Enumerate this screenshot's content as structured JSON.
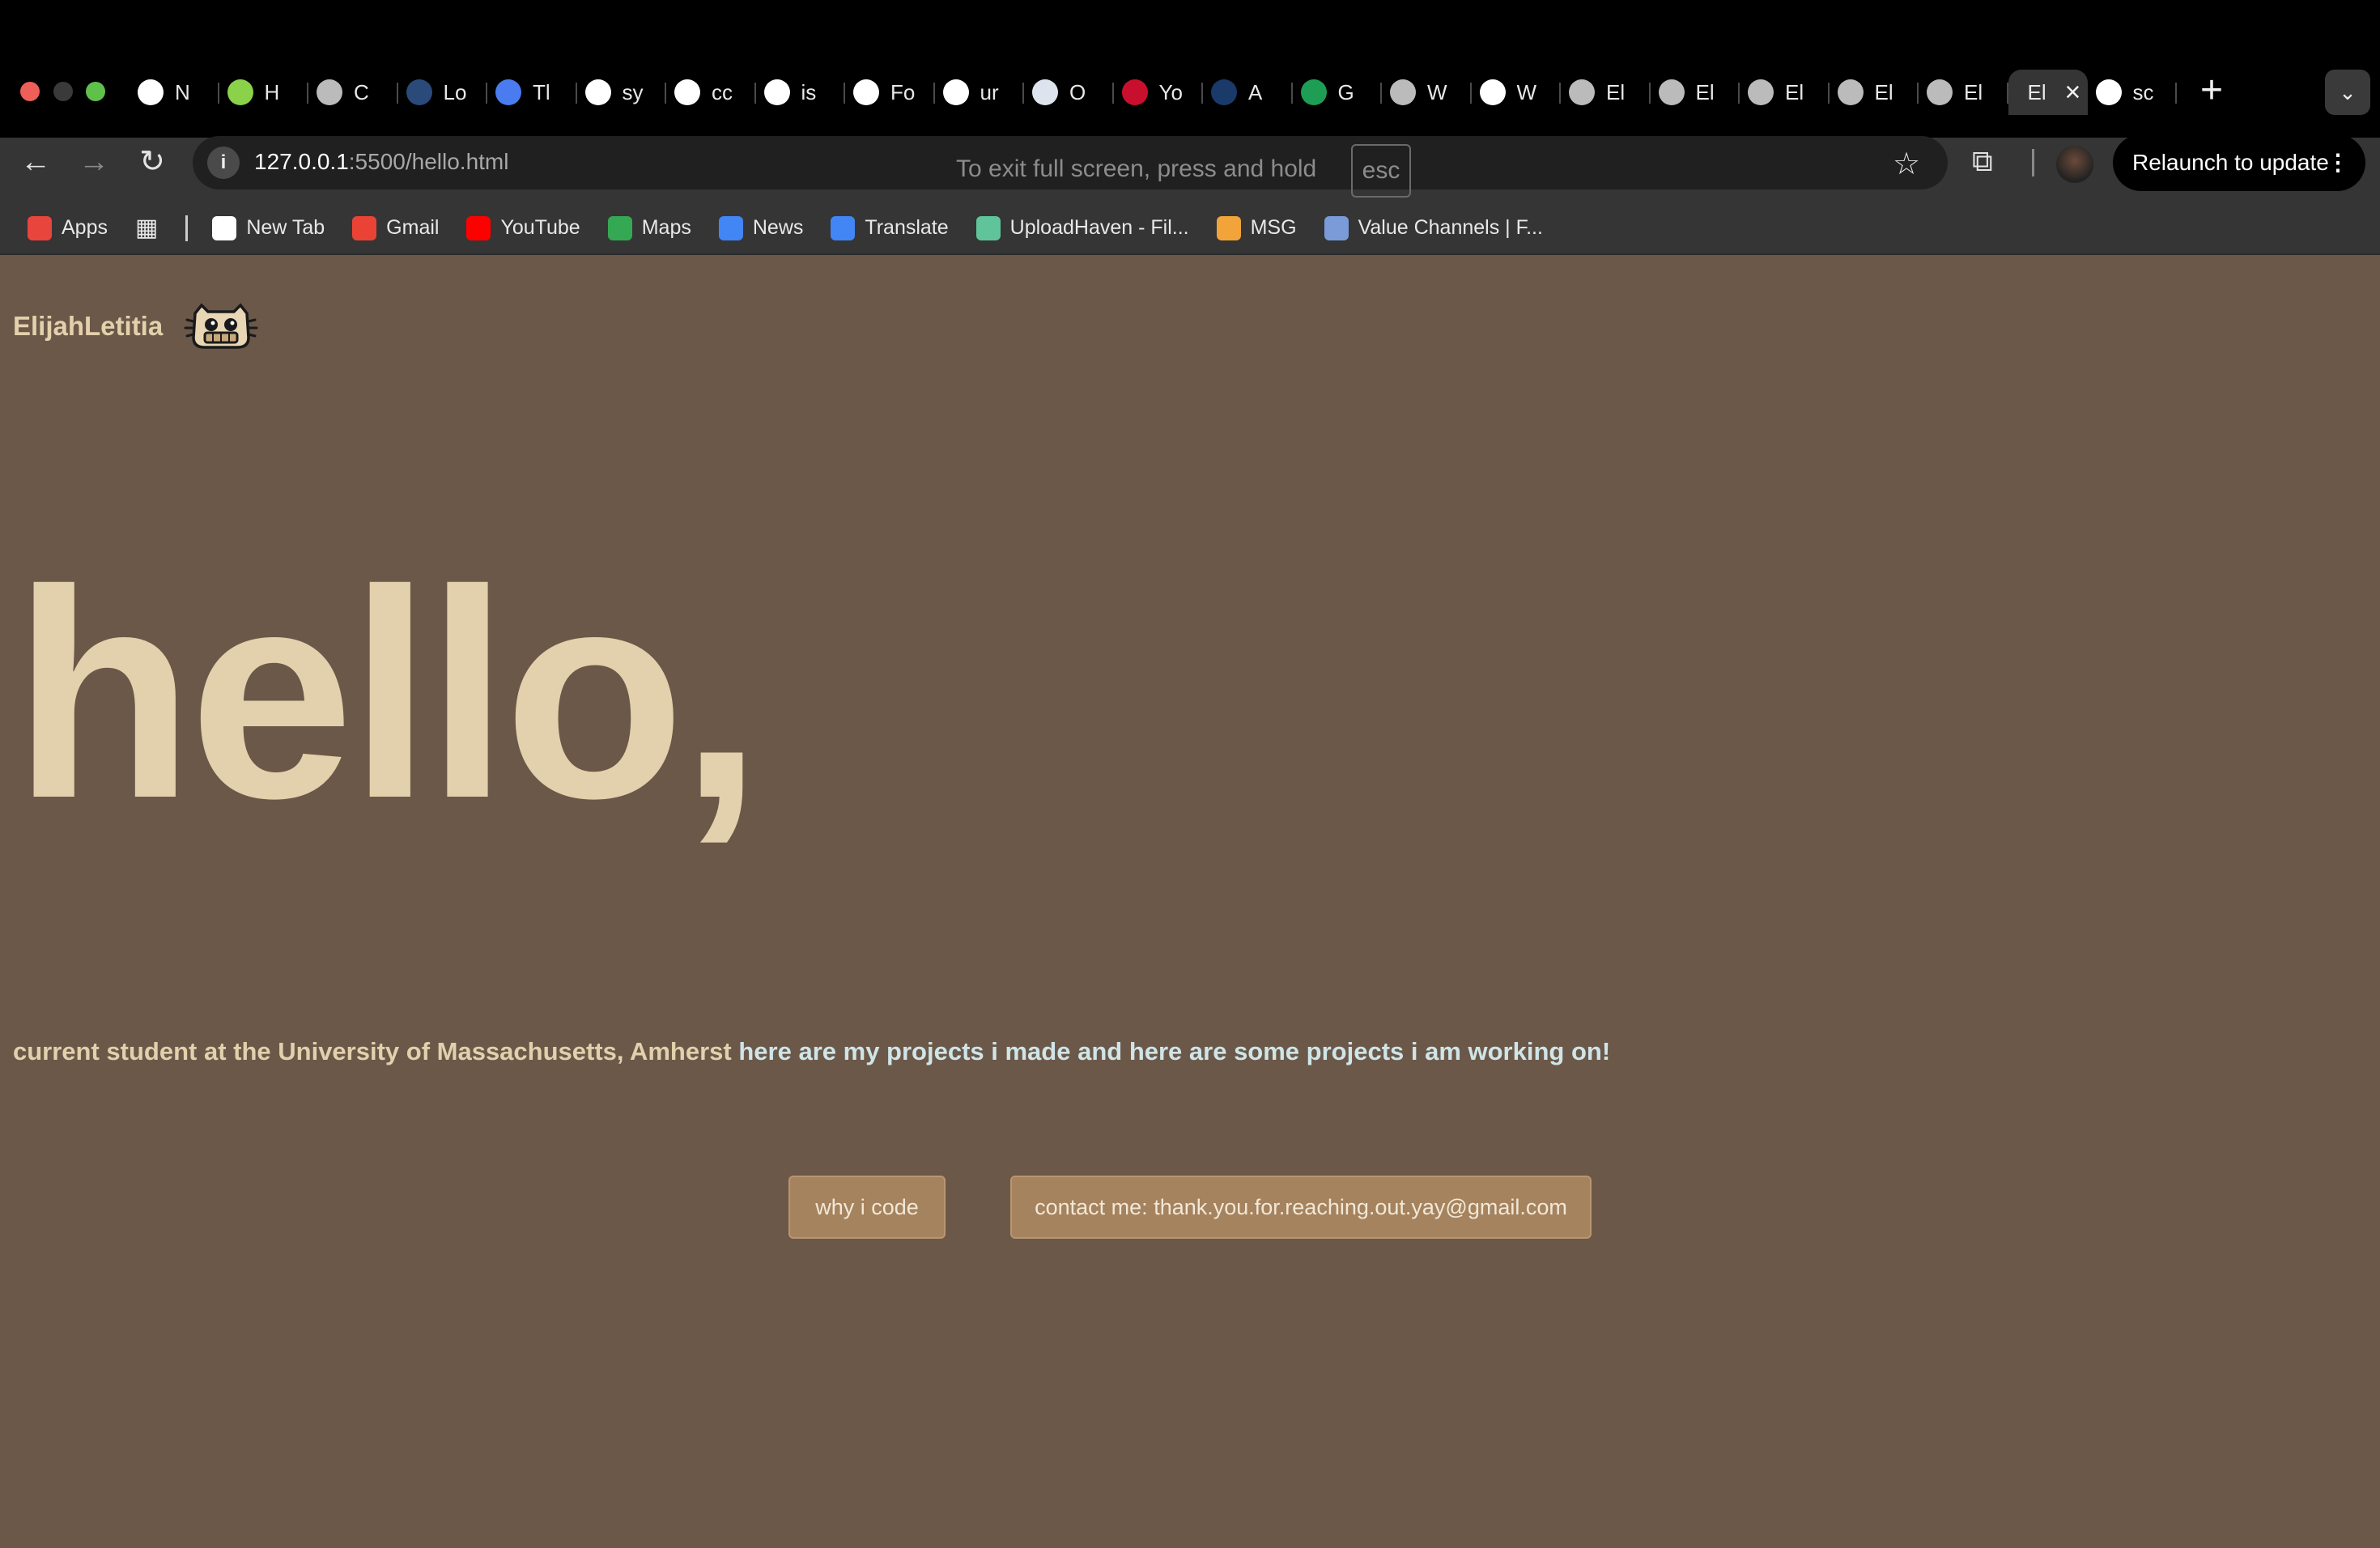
{
  "browser": {
    "tabs": [
      {
        "title": "N",
        "icon": "chrome-icon",
        "color": "#ffffff"
      },
      {
        "title": "H",
        "icon": "hackerrank-icon",
        "color": "#8bd24a"
      },
      {
        "title": "C",
        "icon": "globe-icon",
        "color": "#bbbbbb"
      },
      {
        "title": "Lo",
        "icon": "fsa-icon",
        "color": "#2a4a7a"
      },
      {
        "title": "Tl",
        "icon": "docs-icon",
        "color": "#4a7cf0"
      },
      {
        "title": "sy",
        "icon": "google-icon",
        "color": "#ffffff"
      },
      {
        "title": "cc",
        "icon": "google-icon",
        "color": "#ffffff"
      },
      {
        "title": "is",
        "icon": "google-icon",
        "color": "#ffffff"
      },
      {
        "title": "Fo",
        "icon": "openai-icon",
        "color": "#ffffff"
      },
      {
        "title": "ur",
        "icon": "google-icon",
        "color": "#ffffff"
      },
      {
        "title": "O",
        "icon": "shield-icon",
        "color": "#dde4ee"
      },
      {
        "title": "Yo",
        "icon": "flag-icon",
        "color": "#c8102e"
      },
      {
        "title": "A",
        "icon": "globe-dark-icon",
        "color": "#1a3a6a"
      },
      {
        "title": "G",
        "icon": "sheets-icon",
        "color": "#1e9e55"
      },
      {
        "title": "W",
        "icon": "globe-icon",
        "color": "#bbbbbb"
      },
      {
        "title": "W",
        "icon": "openai-icon",
        "color": "#ffffff"
      },
      {
        "title": "El",
        "icon": "globe-icon",
        "color": "#bbbbbb"
      },
      {
        "title": "El",
        "icon": "globe-icon",
        "color": "#bbbbbb"
      },
      {
        "title": "El",
        "icon": "globe-icon",
        "color": "#bbbbbb"
      },
      {
        "title": "El",
        "icon": "globe-icon",
        "color": "#bbbbbb"
      },
      {
        "title": "El",
        "icon": "globe-icon",
        "color": "#bbbbbb"
      }
    ],
    "active_tab": {
      "title": "El"
    },
    "last_tab": {
      "title": "sc",
      "icon": "google-icon",
      "color": "#ffffff"
    },
    "url_host": "127.0.0.1",
    "url_path": ":5500/hello.html",
    "fullscreen_hint": "To exit full screen, press and hold",
    "fullscreen_key": "esc",
    "relaunch_label": "Relaunch to update",
    "bookmarks": [
      {
        "label": "Apps",
        "icon": "apps-grid-icon",
        "color": "#e8453c"
      },
      {
        "label": "New Tab",
        "icon": "globe-icon",
        "color": "#ffffff"
      },
      {
        "label": "Gmail",
        "icon": "gmail-icon",
        "color": "#ea4335"
      },
      {
        "label": "YouTube",
        "icon": "youtube-icon",
        "color": "#ff0000"
      },
      {
        "label": "Maps",
        "icon": "maps-icon",
        "color": "#34a853"
      },
      {
        "label": "News",
        "icon": "news-icon",
        "color": "#4285f4"
      },
      {
        "label": "Translate",
        "icon": "translate-icon",
        "color": "#4285f4"
      },
      {
        "label": "UploadHaven - Fil...",
        "icon": "cloud-icon",
        "color": "#5fc49a"
      },
      {
        "label": "MSG",
        "icon": "msg-icon",
        "color": "#f2a33a"
      },
      {
        "label": "Value Channels | F...",
        "icon": "value-channels-icon",
        "color": "#7a9ad8"
      }
    ]
  },
  "page": {
    "brand": "ElijahLetitia",
    "headline": "hello,",
    "intro": "current student at the University of Massachusetts, Amherst",
    "link_projects_made": "here are my projects i made",
    "link_joiner": " and ",
    "link_projects_working": "here are some projects i am working on!",
    "btn_why": "why i code",
    "btn_contact": "contact me: thank.you.for.reaching.out.yay@gmail.com",
    "colors": {
      "background": "#6b5849",
      "text": "#e3d0ac",
      "link": "#cfe5e8",
      "button": "#a5835f"
    }
  }
}
